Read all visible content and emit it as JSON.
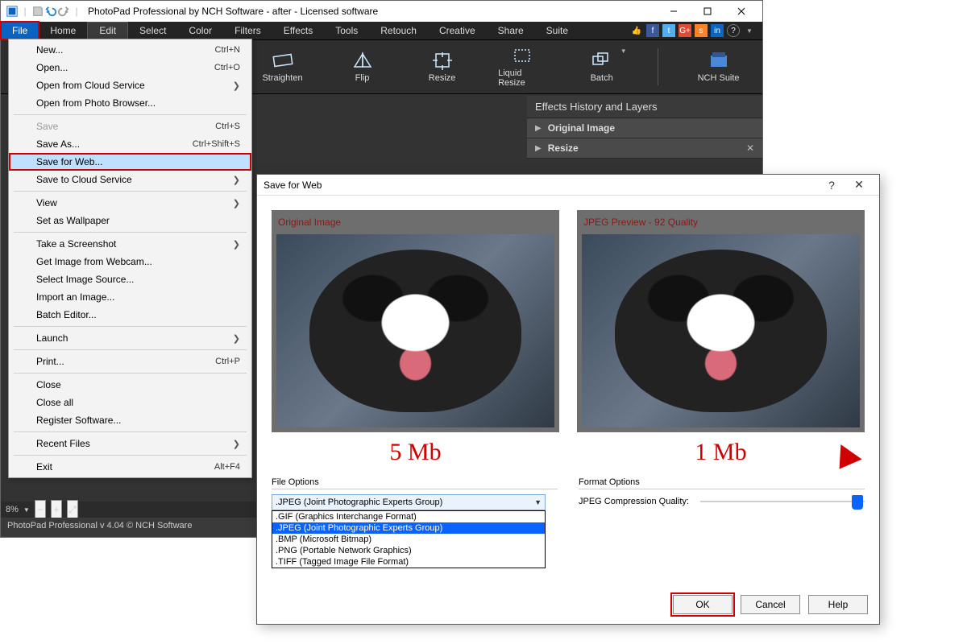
{
  "app": {
    "title": "PhotoPad Professional by NCH Software - after - Licensed software",
    "menubar": [
      "File",
      "Home",
      "Edit",
      "Select",
      "Color",
      "Filters",
      "Effects",
      "Tools",
      "Retouch",
      "Creative",
      "Share",
      "Suite"
    ],
    "toolbar": {
      "straighten": "Straighten",
      "flip": "Flip",
      "resize": "Resize",
      "liquid": "Liquid Resize",
      "batch": "Batch",
      "nch": "NCH Suite"
    },
    "rightPanel": {
      "title": "Effects History and Layers",
      "rows": [
        "Original Image",
        "Resize"
      ]
    },
    "zoom": "8%",
    "status": "PhotoPad Professional v 4.04 © NCH Software"
  },
  "fileMenu": {
    "items": [
      {
        "label": "New...",
        "shortcut": "Ctrl+N"
      },
      {
        "label": "Open...",
        "shortcut": "Ctrl+O"
      },
      {
        "label": "Open from Cloud Service",
        "sub": true
      },
      {
        "label": "Open from Photo Browser..."
      },
      {
        "sep": true
      },
      {
        "label": "Save",
        "shortcut": "Ctrl+S",
        "disabled": true
      },
      {
        "label": "Save As...",
        "shortcut": "Ctrl+Shift+S"
      },
      {
        "label": "Save for Web...",
        "hlbox": true
      },
      {
        "label": "Save to Cloud Service",
        "sub": true
      },
      {
        "sep": true
      },
      {
        "label": "View",
        "sub": true
      },
      {
        "label": "Set as Wallpaper"
      },
      {
        "sep": true
      },
      {
        "label": "Take a Screenshot",
        "sub": true
      },
      {
        "label": "Get Image from Webcam..."
      },
      {
        "label": "Select Image Source..."
      },
      {
        "label": "Import an Image..."
      },
      {
        "label": "Batch Editor..."
      },
      {
        "sep": true
      },
      {
        "label": "Launch",
        "sub": true
      },
      {
        "sep": true
      },
      {
        "label": "Print...",
        "shortcut": "Ctrl+P"
      },
      {
        "sep": true
      },
      {
        "label": "Close"
      },
      {
        "label": "Close all"
      },
      {
        "label": "Register Software..."
      },
      {
        "sep": true
      },
      {
        "label": "Recent Files",
        "sub": true
      },
      {
        "sep": true
      },
      {
        "label": "Exit",
        "shortcut": "Alt+F4"
      }
    ]
  },
  "dialog": {
    "title": "Save for Web",
    "left": {
      "head": "Original Image",
      "size": "5 Mb"
    },
    "right": {
      "head": "JPEG Preview - 92 Quality",
      "size": "1 Mb"
    },
    "fileOptions": {
      "title": "File Options",
      "selected": ".JPEG (Joint Photographic Experts Group)",
      "list": [
        ".GIF (Graphics Interchange Format)",
        ".JPEG (Joint Photographic Experts Group)",
        ".BMP (Microsoft Bitmap)",
        ".PNG (Portable Network Graphics)",
        ".TIFF (Tagged Image File Format)"
      ],
      "selectedIndex": 1
    },
    "formatOptions": {
      "title": "Format Options",
      "label": "JPEG Compression Quality:",
      "value": 92
    },
    "buttons": {
      "ok": "OK",
      "cancel": "Cancel",
      "help": "Help"
    }
  }
}
